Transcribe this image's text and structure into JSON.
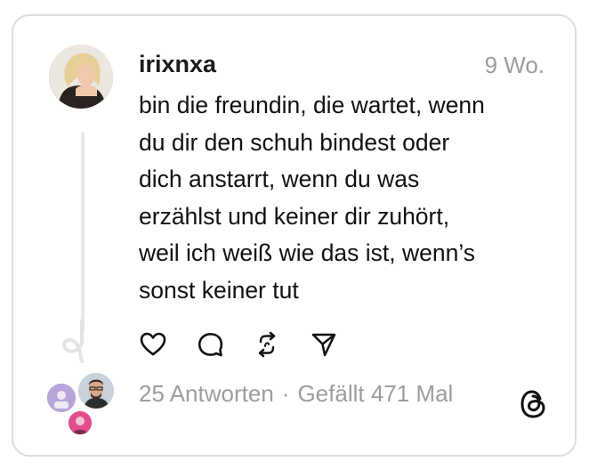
{
  "post": {
    "username": "irixnxa",
    "time": "9 Wo.",
    "text": "bin die freundin, die wartet, wenn\ndu dir den schuh bindest oder\ndich anstarrt, wenn du was\nerzählst und keiner dir zuhört,\nweil ich weiß wie das ist, wenn’s\nsonst keiner tut"
  },
  "actions": {
    "like_icon": "heart-icon",
    "reply_icon": "comment-icon",
    "repost_icon": "repost-icon",
    "share_icon": "send-icon"
  },
  "stats": {
    "replies": "25 Antworten",
    "separator": "·",
    "likes": "Gefällt 471 Mal"
  },
  "colors": {
    "text": "#111111",
    "muted": "#9c9c9c",
    "border": "#dcdcdc"
  }
}
